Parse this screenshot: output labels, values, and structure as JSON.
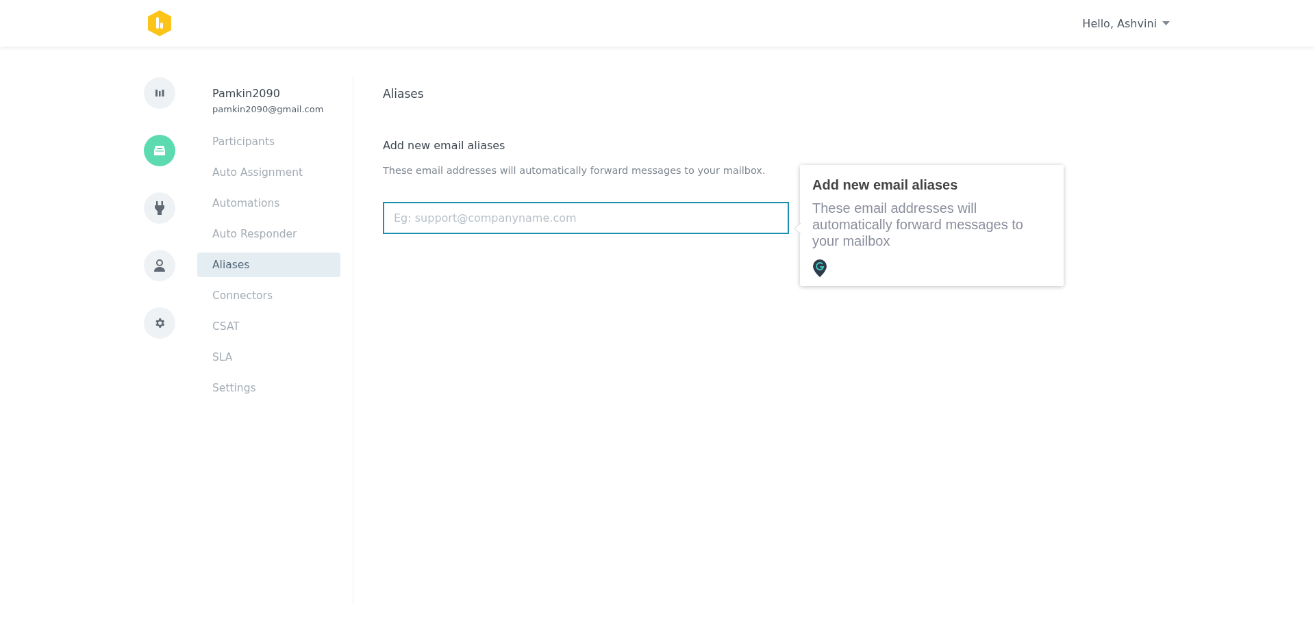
{
  "header": {
    "greeting": "Hello, Ashvini"
  },
  "rail": [
    {
      "kind": "reports",
      "selected": false
    },
    {
      "kind": "inbox",
      "selected": true
    },
    {
      "kind": "plug",
      "selected": false
    },
    {
      "kind": "user",
      "selected": false
    },
    {
      "kind": "settings",
      "selected": false
    }
  ],
  "account": {
    "name": "Pamkin2090",
    "email": "pamkin2090@gmail.com"
  },
  "menu": [
    {
      "label": "Participants",
      "selected": false
    },
    {
      "label": "Auto Assignment",
      "selected": false
    },
    {
      "label": "Automations",
      "selected": false
    },
    {
      "label": "Auto Responder",
      "selected": false
    },
    {
      "label": "Aliases",
      "selected": true
    },
    {
      "label": "Connectors",
      "selected": false
    },
    {
      "label": "CSAT",
      "selected": false
    },
    {
      "label": "SLA",
      "selected": false
    },
    {
      "label": "Settings",
      "selected": false
    }
  ],
  "content": {
    "title": "Aliases",
    "section": "Add new email aliases",
    "description": "These email addresses will automatically forward messages to your mailbox.",
    "input": {
      "placeholder": "Eg: support@companyname.com"
    }
  },
  "tooltip": {
    "title": "Add new email aliases",
    "body": "These email addresses will automatically forward messages to your mailbox"
  }
}
